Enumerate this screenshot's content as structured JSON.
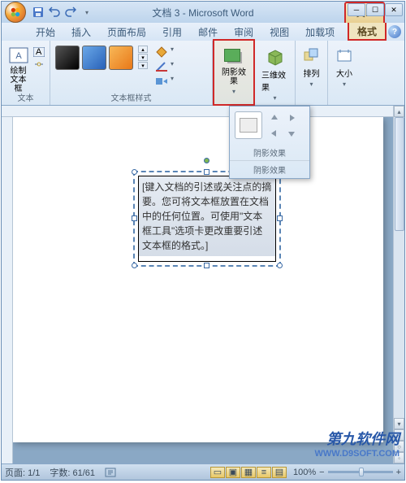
{
  "title": "文档 3 - Microsoft Word",
  "context_tab": "文...",
  "tabs": {
    "home": "开始",
    "insert": "插入",
    "layout": "页面布局",
    "references": "引用",
    "mail": "邮件",
    "review": "审阅",
    "view": "视图",
    "addins": "加载项",
    "format": "格式"
  },
  "ribbon": {
    "group_text": "文本",
    "group_textbox_styles": "文本框样式",
    "group_shadow": "阴影效果",
    "group_3d": "三维效果",
    "group_arrange": "排列",
    "group_size": "大小",
    "draw_textbox": "绘制\n文本框"
  },
  "dropdown": {
    "shadow_label": "阴影效果",
    "panel_label": "阴影效果"
  },
  "textbox_content": "[键入文档的引述或关注点的摘要。您可将文本框放置在文档中的任何位置。可使用\"文本框工具\"选项卡更改重要引述文本框的格式。]",
  "status": {
    "page": "页面: 1/1",
    "words": "字数: 61/61",
    "zoom": "100%"
  },
  "watermark": {
    "line1": "第九软件网",
    "line2": "WWW.D9SOFT.COM"
  },
  "chevron": "▾",
  "plus": "+",
  "minus": "−"
}
